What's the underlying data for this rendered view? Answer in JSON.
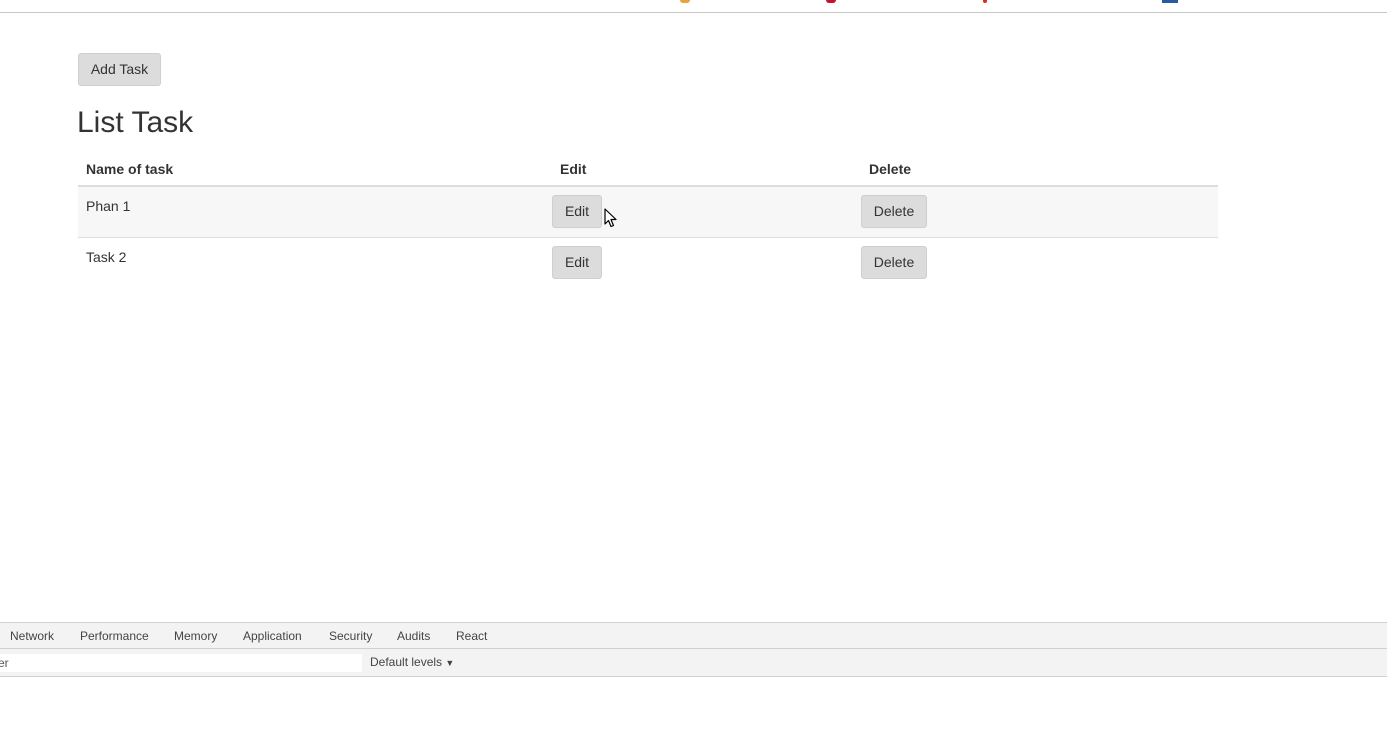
{
  "app": {
    "add_task_label": "Add Task",
    "page_title": "List Task",
    "table": {
      "headers": [
        "Name of task",
        "Edit",
        "Delete"
      ],
      "rows": [
        {
          "name": "Phan 1",
          "edit_label": "Edit",
          "delete_label": "Delete"
        },
        {
          "name": "Task 2",
          "edit_label": "Edit",
          "delete_label": "Delete"
        }
      ]
    }
  },
  "devtools": {
    "tabs": [
      "Network",
      "Performance",
      "Memory",
      "Application",
      "Security",
      "Audits",
      "React"
    ],
    "filter_value": "er",
    "levels_label": "Default levels",
    "levels_arrow": "▼"
  },
  "colors": {
    "button_bg": "#dcdcdc",
    "row_stripe": "#f7f7f7",
    "devtools_bg": "#f3f3f3"
  }
}
